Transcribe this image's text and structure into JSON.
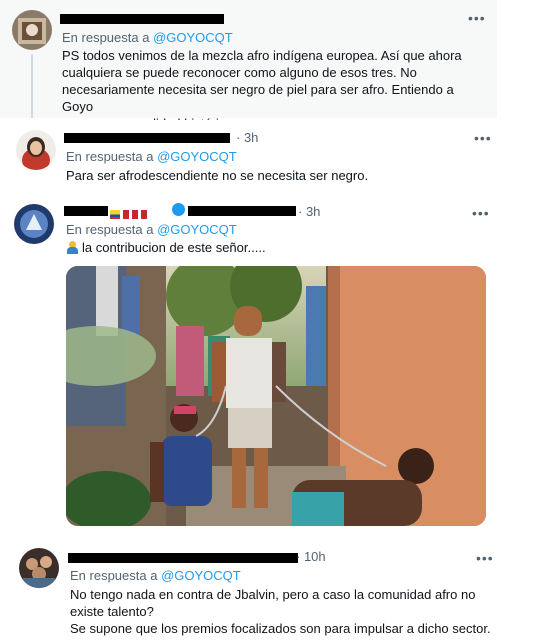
{
  "tweets": [
    {
      "time": "",
      "reply_prefix": "En respuesta a",
      "reply_handle": "@GOYOCQT",
      "lines": [
        "PS todos venimos de la mezcla afro indígena europea. Así que ahora",
        "cualquiera se puede reconocer como alguno de esos tres. No",
        "necesariamente necesita ser negro de piel para ser afro. Entiendo a Goyo",
        "pero es una realidad histórica."
      ]
    },
    {
      "time": "3h",
      "reply_prefix": "En respuesta a",
      "reply_handle": "@GOYOCQT",
      "lines": [
        "Para ser afrodescendiente no se necesita ser negro."
      ]
    },
    {
      "time": "3h",
      "reply_prefix": "En respuesta a",
      "reply_handle": "@GOYOCQT",
      "lines": [
        "la contribucion de este señor....."
      ],
      "emoji": "person-shrugging-emoji",
      "badge": "verified-badge-icon"
    },
    {
      "time": "10h",
      "reply_prefix": "En respuesta a",
      "reply_handle": "@GOYOCQT",
      "lines": [
        "No tengo nada en contra de Jbalvin, pero a caso la comunidad afro no",
        "existe talento?",
        "Se supone que los premios focalizados son para impulsar a dicho sector."
      ]
    }
  ],
  "more_label": "•••",
  "colors": {
    "link": "#1d9bf0",
    "secondary": "#536471",
    "text": "#0f1419",
    "highlight_bg": "#f7f9f9"
  }
}
